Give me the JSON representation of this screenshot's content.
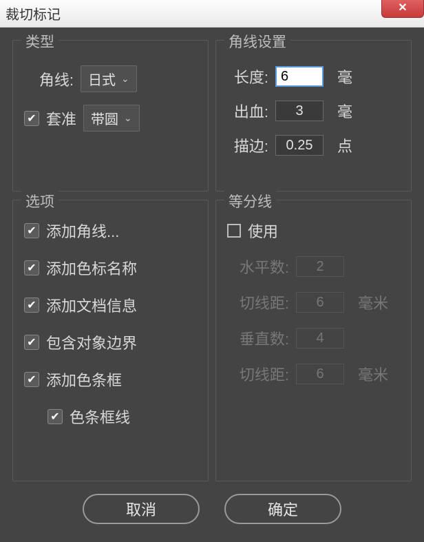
{
  "window": {
    "title": "裁切标记"
  },
  "type_group": {
    "title": "类型",
    "corner_label": "角线:",
    "corner_value": "日式",
    "registration_label": "套准",
    "registration_checked": true,
    "registration_value": "带圆"
  },
  "corner_settings": {
    "title": "角线设置",
    "length_label": "长度:",
    "length_value": "6",
    "length_unit": "毫",
    "bleed_label": "出血:",
    "bleed_value": "3",
    "bleed_unit": "毫",
    "stroke_label": "描边:",
    "stroke_value": "0.25",
    "stroke_unit": "点"
  },
  "options": {
    "title": "选项",
    "items": [
      {
        "label": "添加角线...",
        "checked": true
      },
      {
        "label": "添加色标名称",
        "checked": true
      },
      {
        "label": "添加文档信息",
        "checked": true
      },
      {
        "label": "包含对象边界",
        "checked": true
      },
      {
        "label": "添加色条框",
        "checked": true
      },
      {
        "label": "色条框线",
        "checked": true,
        "sub": true
      }
    ]
  },
  "dividers": {
    "title": "等分线",
    "use_label": "使用",
    "use_checked": false,
    "h_count_label": "水平数:",
    "h_count_value": "2",
    "h_dist_label": "切线距:",
    "h_dist_value": "6",
    "h_dist_unit": "毫米",
    "v_count_label": "垂直数:",
    "v_count_value": "4",
    "v_dist_label": "切线距:",
    "v_dist_value": "6",
    "v_dist_unit": "毫米"
  },
  "buttons": {
    "cancel": "取消",
    "ok": "确定"
  }
}
